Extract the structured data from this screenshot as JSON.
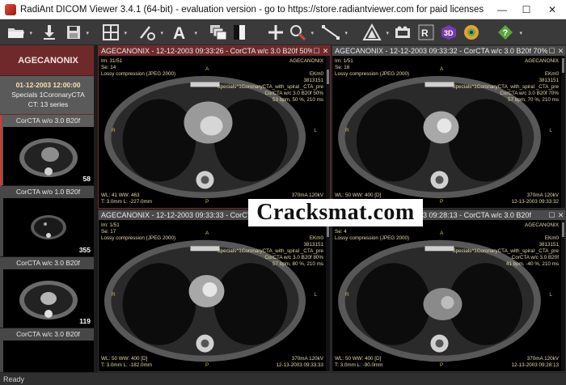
{
  "window": {
    "title": "RadiAnt DICOM Viewer 3.4.1 (64-bit) - evaluation version - go to https://store.radiantviewer.com for paid licenses",
    "min": "—",
    "max": "☐",
    "close": "✕"
  },
  "toolbar": {
    "icons": [
      "open-folder-icon",
      "download-icon",
      "save-icon",
      "layout-grid-icon",
      "measure-icon",
      "text-annotation-icon",
      "series-stack-icon",
      "window-level-icon",
      "crosshair-icon",
      "magnifier-icon",
      "ruler-icon",
      "fusion-icon",
      "export-video-icon",
      "mpr-icon",
      "3d-icon",
      "volume-icon",
      "help-icon"
    ]
  },
  "sidebar": {
    "patient": "AGECANONIX",
    "study": {
      "date": "01-12-2003 12:00:00",
      "desc": "Specials 1CoronaryCTA",
      "count": "CT: 13 series"
    },
    "series": [
      {
        "label": "CorCTA w/o  3.0  B20f",
        "count": "58"
      },
      {
        "label": "CorCTA w/o  1.0  B20f",
        "count": "355"
      },
      {
        "label": "CorCTA w/c  3.0  B20f",
        "count": "119"
      },
      {
        "label": "CorCTA w/c  3.0  B20f",
        "count": ""
      }
    ]
  },
  "viewports": [
    {
      "title": "AGECANONIX - 12-12-2003 09:33:26 - CorCTA w/c 3.0 B20f 50%",
      "tl": [
        "Im: 31/51",
        "Se: 14",
        "Lossy compression (JPEG 2000)"
      ],
      "tr": [
        "AGECANONIX",
        "",
        "EKm0",
        "3813151",
        "Specials^1CoronaryCTA_with_spiral _CTA_pre",
        "CorCTA w/c  3.0  B20f  50%",
        "53 bpm, 50 %, 210 ms"
      ],
      "bl": [
        "WL: 41 WW: 463",
        "T: 3.0mm L: -227.0mm"
      ],
      "br": [
        "370mA 120kV",
        "12-13-2003 09:33:24"
      ],
      "markers": {
        "top": "A",
        "left": "R",
        "right": "L",
        "bottom": "P"
      }
    },
    {
      "title": "AGECANONIX - 12-12-2003 09:33:32 - CorCTA w/c 3.0 B20f 70%",
      "tl": [
        "Im: 1/51",
        "Se: 16",
        "Lossy compression (JPEG 2000)"
      ],
      "tr": [
        "AGECANONIX",
        "",
        "EKm0",
        "3813151",
        "Specials^1CoronaryCTA_with_spiral _CTA_pre",
        "CorCTA w/c  3.0  B20f  70%",
        "57 bpm, 70 %, 210 ms"
      ],
      "bl": [
        "WL: 50 WW: 400 [D]",
        "T: 3.0mm L: -58.0mm"
      ],
      "br": [
        "370mA 120kV",
        "12-13-2003 09:33:32"
      ],
      "markers": {
        "top": "A",
        "left": "R",
        "right": "L",
        "bottom": "P"
      }
    },
    {
      "title": "AGECANONIX - 12-12-2003 09:33:33 - CorCTA w/c 3.0 B20f 80%",
      "tl": [
        "Im: 1/51",
        "Se: 17",
        "Lossy compression (JPEG 2000)"
      ],
      "tr": [
        "AGECANONIX",
        "",
        "EKm0",
        "3813151",
        "Specials^1CoronaryCTA_with_spiral _CTA_pre",
        "CorCTA w/c  3.0  B20f  80%",
        "57 bpm, 80 %, 210 ms"
      ],
      "bl": [
        "WL: 50 WW: 400 [D]",
        "T: 3.0mm L: -182.0mm"
      ],
      "br": [
        "370mA 120kV",
        "12-13-2003 09:33:33"
      ],
      "markers": {
        "top": "A",
        "left": "R",
        "right": "L",
        "bottom": "P"
      }
    },
    {
      "title": "AGECANONIX - 12-12-2003 09:28:13 - CorCTA w/c 3.0 B20f",
      "tl": [
        "Im: 1/58",
        "Se: 4",
        "Lossy compression (JPEG 2000)"
      ],
      "tr": [
        "AGECANONIX",
        "",
        "EKm0",
        "3813151",
        "Specials^1CoronaryCTA_with_spiral _CTA_pre",
        "CorCTA w/c  3.0  B20f",
        "41 bpm, -40 %, 210 ms"
      ],
      "bl": [
        "WL: 50 WW: 400 [D]",
        "T: 3.0mm L: -90.0mm"
      ],
      "br": [
        "370mA 120kV",
        "12-13-2003 09:28:13"
      ],
      "markers": {
        "top": "A",
        "left": "R",
        "right": "L",
        "bottom": "P"
      }
    }
  ],
  "watermark": "Cracksmat.com",
  "status": "Ready",
  "colors": {
    "accent": "#6f2a2a",
    "overlay_text": "#e7d9a8",
    "selection": "#d23b2e"
  }
}
